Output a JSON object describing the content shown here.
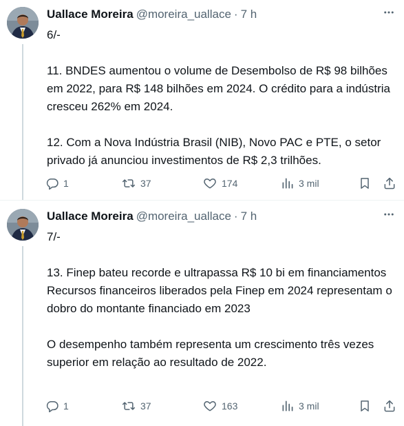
{
  "tweets": [
    {
      "author_name": "Uallace Moreira",
      "handle": "@moreira_uallace",
      "separator": "·",
      "time": "7 h",
      "paragraphs": [
        "6/-",
        "11. BNDES aumentou o volume de Desembolso de R$ 98 bilhões em 2022, para R$ 148 bilhões em 2024. O crédito para a indústria cresceu 262% em 2024.",
        "12. Com a Nova Indústria Brasil (NIB), Novo PAC e PTE, o setor privado já anunciou investimentos de R$ 2,3 trilhões."
      ],
      "stats": {
        "replies": "1",
        "retweets": "37",
        "likes": "174",
        "views": "3 mil"
      }
    },
    {
      "author_name": "Uallace Moreira",
      "handle": "@moreira_uallace",
      "separator": "·",
      "time": "7 h",
      "paragraphs": [
        "7/-",
        "13. Finep bateu recorde e ultrapassa R$ 10 bi em financiamentos\nRecursos financeiros liberados pela Finep em 2024 representam o dobro do montante financiado em 2023",
        "O desempenho também representa um crescimento três vezes superior em relação ao resultado de 2022."
      ],
      "stats": {
        "replies": "1",
        "retweets": "37",
        "likes": "163",
        "views": "3 mil"
      }
    }
  ],
  "icons": {
    "reply": "reply-icon",
    "retweet": "retweet-icon",
    "like": "heart-icon",
    "views": "views-icon",
    "bookmark": "bookmark-icon",
    "share": "share-icon",
    "more": "more-options-icon"
  },
  "colors": {
    "text": "#0f1419",
    "secondary": "#536471",
    "thread_line": "#cfd9de",
    "divider": "#eff3f4"
  }
}
